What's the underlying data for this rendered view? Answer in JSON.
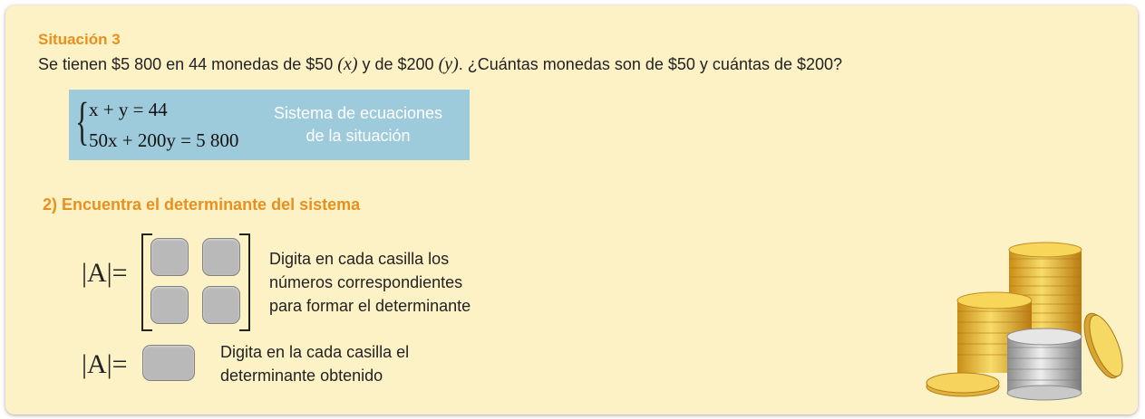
{
  "situation": {
    "title": "Situación 3",
    "text_a": "Se tienen $5 800 en 44 monedas de $50 ",
    "var_x": "(x)",
    "text_b": " y de $200 ",
    "var_y": "(y)",
    "text_c": ". ¿Cuántas monedas son de $50 y cuántas de $200?"
  },
  "system": {
    "brace": "{",
    "eq1": "x + y = 44",
    "eq2": "50x + 200y = 5 800",
    "label_line1": "Sistema de ecuaciones",
    "label_line2": "de la situación",
    "box_color": "#9ecbdc"
  },
  "step": {
    "title": "2) Encuentra el determinante del sistema",
    "det_label": "|A|=",
    "matrix_instruction_1": "Digita en cada casilla los",
    "matrix_instruction_2": "números correspondientes",
    "matrix_instruction_3": "para formar el determinante",
    "result_instruction_1": "Digita en la cada casilla el",
    "result_instruction_2": "determinante obtenido"
  },
  "colors": {
    "card_bg": "#fdf2c6",
    "accent": "#e8901e",
    "cell": "#b9b9b9"
  },
  "decor": {
    "image": "coin-stacks-illustration"
  }
}
